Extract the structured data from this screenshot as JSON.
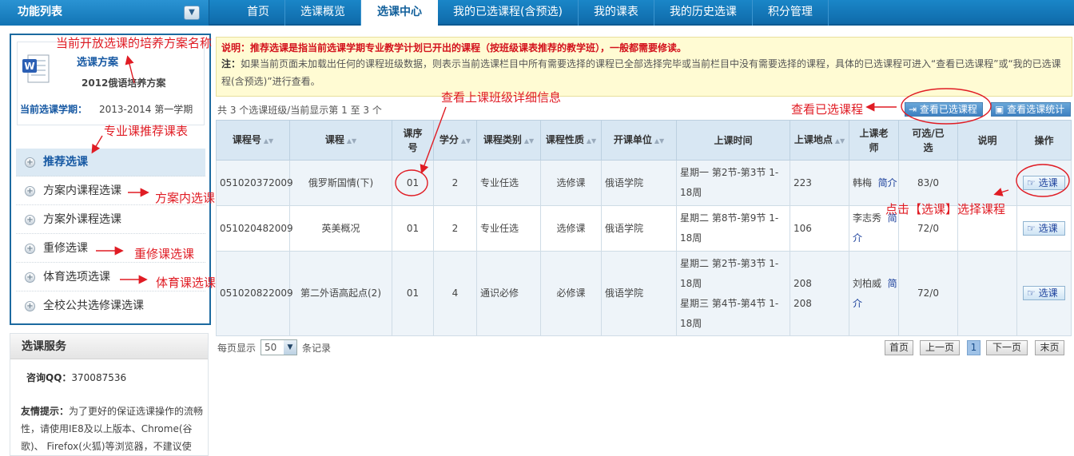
{
  "header": {
    "menu_title": "功能列表",
    "toggle_glyph": "▼",
    "nav_tabs": [
      "首页",
      "选课概览",
      "选课中心",
      "我的已选课程(含预选)",
      "我的课表",
      "我的历史选课",
      "积分管理"
    ],
    "active_tab": "选课中心"
  },
  "sidebar": {
    "scheme_label": "选课方案",
    "scheme_name": "2012俄语培养方案",
    "term_label": "当前选课学期：",
    "term_value": "2013-2014 第一学期",
    "items": [
      {
        "label": "推荐选课",
        "active": true
      },
      {
        "label": "方案内课程选课"
      },
      {
        "label": "方案外课程选课"
      },
      {
        "label": "重修选课"
      },
      {
        "label": "体育选项选课"
      },
      {
        "label": "全校公共选修课选课"
      }
    ]
  },
  "service": {
    "title": "选课服务",
    "qq_label": "咨询QQ：",
    "qq_value": "370087536",
    "tip_label": "友情提示：",
    "tip_text": "为了更好的保证选课操作的流畅性，请使用IE8及以上版本、Chrome(谷歌)、 Firefox(火狐)等浏览器，不建议使"
  },
  "notice": {
    "title": "说明：推荐选课是指当前选课学期专业教学计划已开出的课程（按班级课表推荐的教学班），一般都需要修读。",
    "body_label": "注：",
    "body_text": "如果当前页面未加载出任何的课程班级数据，则表示当前选课栏目中所有需要选择的课程已全部选择完毕或当前栏目中没有需要选择的课程，具体的已选课程可进入“查看已选课程”或“我的已选课程(含预选)”进行查看。"
  },
  "toolbar": {
    "count_text": "共 3 个选课班级/当前显示第 1 至 3 个",
    "view_selected": "查看已选课程",
    "view_stats": "查看选课统计"
  },
  "table": {
    "headers": [
      "课程号",
      "课程",
      "课序号",
      "学分",
      "课程类别",
      "课程性质",
      "开课单位",
      "上课时间",
      "上课地点",
      "上课老师",
      "可选/已选",
      "说明",
      "操作"
    ],
    "rows": [
      {
        "code": "051020372009",
        "name": "俄罗斯国情(下)",
        "seq": "01",
        "credit": "2",
        "category": "专业任选",
        "nature": "选修课",
        "unit": "俄语学院",
        "time": [
          "星期一 第2节-第3节 1-18周"
        ],
        "place": [
          "223"
        ],
        "teacher": "韩梅",
        "intro": "简介",
        "avail": "83/0",
        "note": "",
        "action": "选课"
      },
      {
        "code": "051020482009",
        "name": "英美概况",
        "seq": "01",
        "credit": "2",
        "category": "专业任选",
        "nature": "选修课",
        "unit": "俄语学院",
        "time": [
          "星期二 第8节-第9节 1-18周"
        ],
        "place": [
          "106"
        ],
        "teacher": "李志秀",
        "intro": "简介",
        "avail": "72/0",
        "note": "",
        "action": "选课"
      },
      {
        "code": "051020822009",
        "name": "第二外语高起点(2)",
        "seq": "01",
        "credit": "4",
        "category": "通识必修",
        "nature": "必修课",
        "unit": "俄语学院",
        "time": [
          "星期二 第2节-第3节 1-18周",
          "星期三 第4节-第4节 1-18周"
        ],
        "place": [
          "208",
          "208"
        ],
        "teacher": "刘柏威",
        "intro": "简介",
        "avail": "72/0",
        "note": "",
        "action": "选课"
      }
    ]
  },
  "pager": {
    "per_page_label": "每页显示",
    "per_page_value": "50",
    "records_label": "条记录",
    "first": "首页",
    "prev": "上一页",
    "current": "1",
    "next": "下一页",
    "last": "末页"
  },
  "annotations": {
    "scheme": "当前开放选课的培养方案名称",
    "recommend": "专业课推荐课表",
    "inplan": "方案内选课",
    "retake": "重修课选课",
    "pe": "体育课选课",
    "detail": "查看上课班级详细信息",
    "selected": "查看已选课程",
    "choose": "点击【选课】选择课程"
  },
  "colors": {
    "annotation": "#e01c24",
    "header_blue": "#1274b4",
    "link_blue": "#1a3f9b"
  }
}
